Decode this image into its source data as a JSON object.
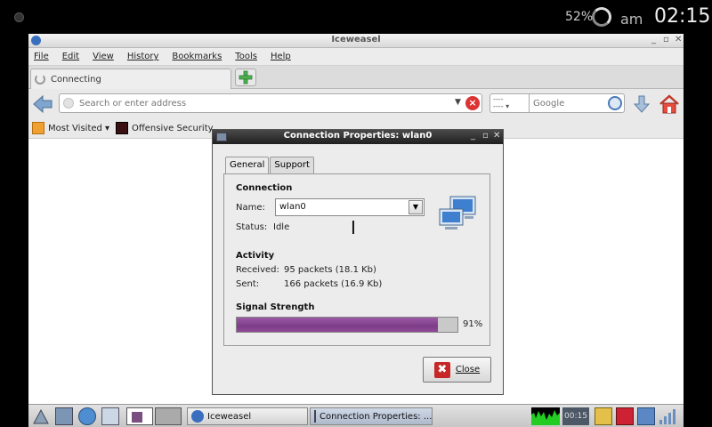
{
  "status_bar": {
    "battery_percent": "52%",
    "ampm": "am",
    "clock": "02:15"
  },
  "browser": {
    "window_title": "Iceweasel",
    "menu": [
      "File",
      "Edit",
      "View",
      "History",
      "Bookmarks",
      "Tools",
      "Help"
    ],
    "tab": {
      "label": "Connecting"
    },
    "urlbar": {
      "placeholder": "Search or enter address"
    },
    "search": {
      "engine": "Google"
    },
    "bookmarks": [
      {
        "label": "Most Visited ▾",
        "icon": "most-visited-icon"
      },
      {
        "label": "Offensive Security",
        "icon": "offsec-icon"
      }
    ]
  },
  "dialog": {
    "title": "Connection Properties: wlan0",
    "tabs": [
      "General",
      "Support"
    ],
    "connection": {
      "heading": "Connection",
      "name_label": "Name:",
      "name_value": "wlan0",
      "status_label": "Status:",
      "status_value": "Idle"
    },
    "activity": {
      "heading": "Activity",
      "received_label": "Received:",
      "received_value": "95 packets (18.1 Kb)",
      "sent_label": "Sent:",
      "sent_value": "166 packets (16.9 Kb)"
    },
    "signal": {
      "heading": "Signal Strength",
      "percent_text": "91%",
      "percent": 91,
      "color": "#8a4a95"
    },
    "close_label": "Close"
  },
  "taskbar": {
    "tasks": [
      {
        "label": "Iceweasel"
      },
      {
        "label": "Connection Properties: ..."
      }
    ],
    "clock": "00:15"
  }
}
